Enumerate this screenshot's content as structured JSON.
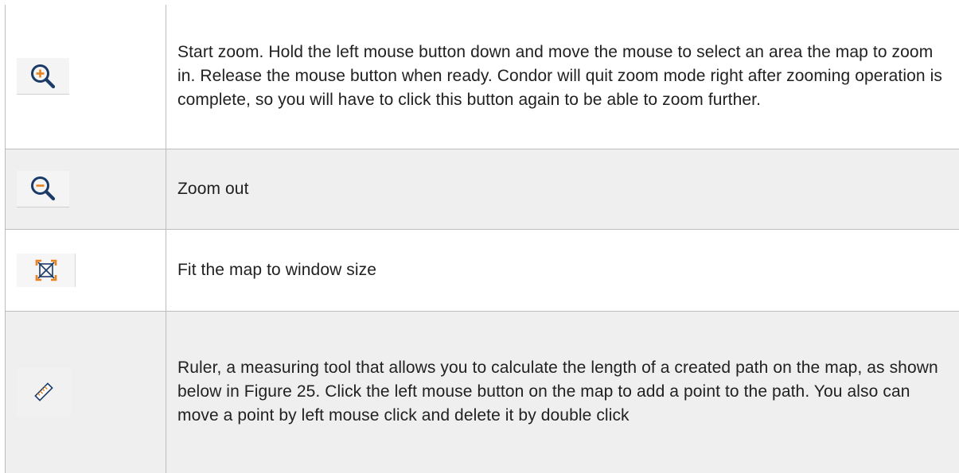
{
  "rows": [
    {
      "icon": "zoom-in-icon",
      "text": "Start zoom. Hold the left mouse button down and move the mouse to select an area the map to zoom in. Release the mouse button when ready. Condor will quit zoom mode right after zooming operation is complete, so you will have to click this button again to be able to zoom further."
    },
    {
      "icon": "zoom-out-icon",
      "text": "Zoom out"
    },
    {
      "icon": "fit-to-window-icon",
      "text": "Fit the map to window size"
    },
    {
      "icon": "ruler-icon",
      "text": "Ruler, a measuring tool that allows you to calculate the length of a created path on the map, as shown below in Figure 25. Click the left mouse button on the map to add a point to the path. You also can move a point by left mouse click and delete it by double click"
    }
  ],
  "colors": {
    "border": "#bdbdbd",
    "shaded_row": "#efefef",
    "icon_navy": "#1a3a68",
    "icon_orange": "#e8821e"
  }
}
